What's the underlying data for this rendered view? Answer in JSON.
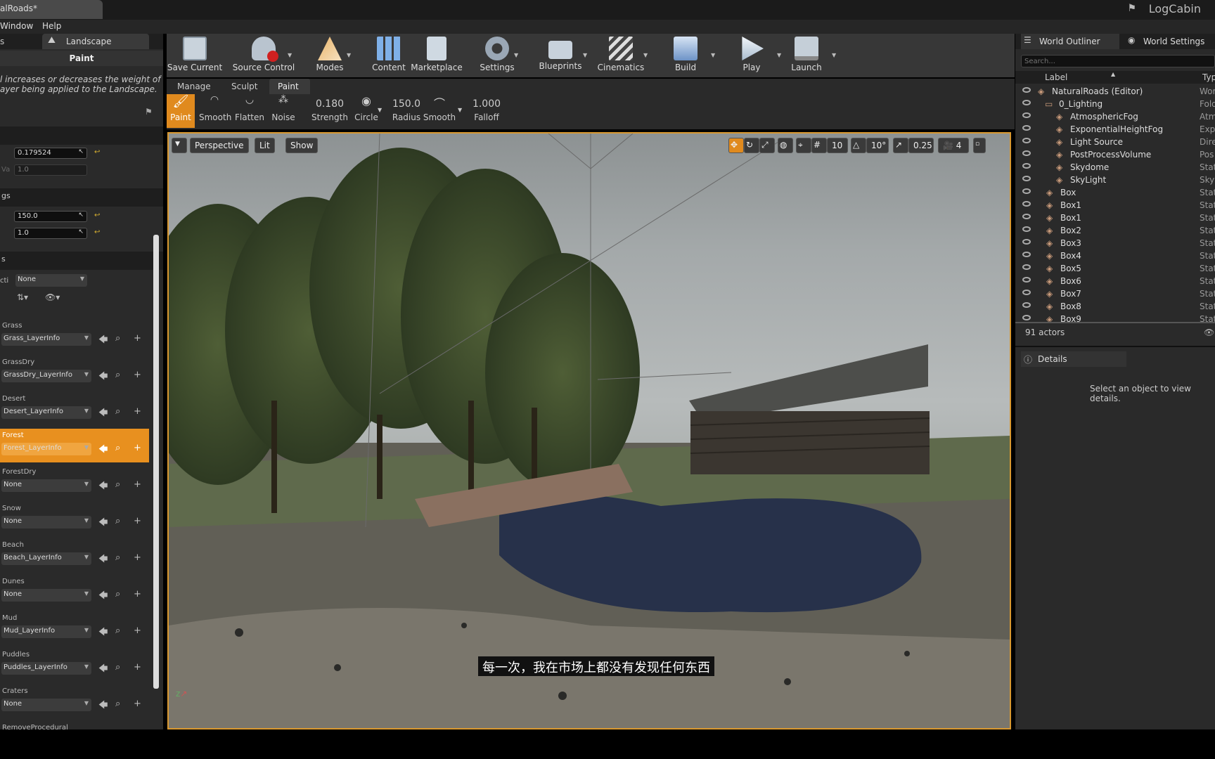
{
  "window": {
    "doc_tab": "alRoads*",
    "project": "LogCabin"
  },
  "menu": {
    "window": "Window",
    "help": "Help"
  },
  "left": {
    "tab_left": "s",
    "tab_label": "Landscape",
    "mode_title": "Paint",
    "description_line1": "l increases or decreases the weight of",
    "description_line2": "ayer being applied to the Landscape.",
    "strength_value": "0.179524",
    "va_label": "Va",
    "va_value": "1.0",
    "settings_label": "gs",
    "radius_value": "150.0",
    "falloff_value": "1.0",
    "layers_label": "s",
    "select_label": "cti",
    "select_value": "None",
    "layers": [
      {
        "name": "Grass",
        "info": "Grass_LayerInfo"
      },
      {
        "name": "GrassDry",
        "info": "GrassDry_LayerInfo"
      },
      {
        "name": "Desert",
        "info": "Desert_LayerInfo"
      },
      {
        "name": "Forest",
        "info": "Forest_LayerInfo"
      },
      {
        "name": "ForestDry",
        "info": "None"
      },
      {
        "name": "Snow",
        "info": "None"
      },
      {
        "name": "Beach",
        "info": "Beach_LayerInfo"
      },
      {
        "name": "Dunes",
        "info": "None"
      },
      {
        "name": "Mud",
        "info": "Mud_LayerInfo"
      },
      {
        "name": "Puddles",
        "info": "Puddles_LayerInfo"
      },
      {
        "name": "Craters",
        "info": "None"
      },
      {
        "name": "RemoveProcedural",
        "info": ""
      }
    ]
  },
  "toolbar": {
    "save_current": "Save Current",
    "source_control": "Source Control",
    "modes": "Modes",
    "content": "Content",
    "marketplace": "Marketplace",
    "settings": "Settings",
    "blueprints": "Blueprints",
    "cinematics": "Cinematics",
    "build": "Build",
    "play": "Play",
    "launch": "Launch"
  },
  "mode_tabs": {
    "manage": "Manage",
    "sculpt": "Sculpt",
    "paint": "Paint"
  },
  "tools": {
    "paint": "Paint",
    "smooth": "Smooth",
    "flatten": "Flatten",
    "noise": "Noise",
    "strength_val": "0.180",
    "strength": "Strength",
    "circle": "Circle",
    "radius_val": "150.0",
    "radius": "Radius",
    "smooth2": "Smooth",
    "falloff_val": "1.000",
    "falloff": "Falloff"
  },
  "viewport": {
    "perspective": "Perspective",
    "lit": "Lit",
    "show": "Show",
    "grid_snap": "10",
    "rot_snap": "10°",
    "scale_snap": "0.25",
    "cam_speed": "4",
    "subtitle": "每一次，我在市场上都没有发现任何东西"
  },
  "outliner": {
    "tab_outliner": "World Outliner",
    "tab_world": "World Settings",
    "search_placeholder": "Search...",
    "col_label": "Label",
    "col_type": "Typ",
    "rows": [
      {
        "label": "NaturalRoads (Editor)",
        "type": "Wor"
      },
      {
        "label": "0_Lighting",
        "type": "Fold"
      },
      {
        "label": "AtmosphericFog",
        "type": "Atm"
      },
      {
        "label": "ExponentialHeightFog",
        "type": "Exp"
      },
      {
        "label": "Light Source",
        "type": "Dire"
      },
      {
        "label": "PostProcessVolume",
        "type": "Pos"
      },
      {
        "label": "Skydome",
        "type": "Stat"
      },
      {
        "label": "SkyLight",
        "type": "Sky"
      },
      {
        "label": "Box",
        "type": "Stat"
      },
      {
        "label": "Box1",
        "type": "Stat"
      },
      {
        "label": "Box1",
        "type": "Stat"
      },
      {
        "label": "Box2",
        "type": "Stat"
      },
      {
        "label": "Box3",
        "type": "Stat"
      },
      {
        "label": "Box4",
        "type": "Stat"
      },
      {
        "label": "Box5",
        "type": "Stat"
      },
      {
        "label": "Box6",
        "type": "Stat"
      },
      {
        "label": "Box7",
        "type": "Stat"
      },
      {
        "label": "Box8",
        "type": "Stat"
      },
      {
        "label": "Box9",
        "type": "Stat"
      }
    ],
    "actor_count": "91 actors",
    "details_tab": "Details",
    "details_empty": "Select an object to view details."
  }
}
